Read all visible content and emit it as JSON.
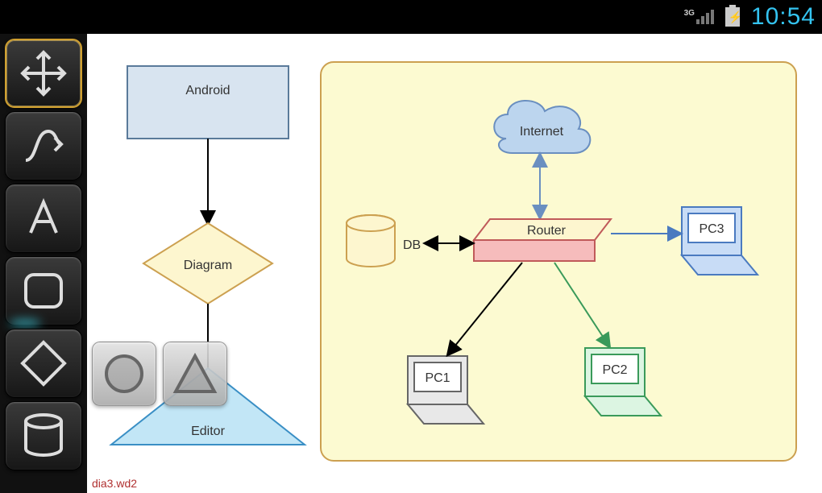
{
  "statusbar": {
    "signal": "3G",
    "time": "10:54"
  },
  "filename": "dia3.wd2",
  "toolbar": {
    "tools": [
      {
        "name": "move",
        "selected": true
      },
      {
        "name": "connector",
        "selected": false
      },
      {
        "name": "text",
        "selected": false
      },
      {
        "name": "rectangle",
        "selected": false,
        "highlight": true
      },
      {
        "name": "diamond",
        "selected": false
      },
      {
        "name": "cylinder",
        "selected": false
      }
    ]
  },
  "floating_tools": [
    {
      "name": "circle"
    },
    {
      "name": "triangle"
    }
  ],
  "diagram": {
    "shapes": {
      "android": {
        "label": "Android",
        "type": "rectangle",
        "fill": "#d8e4f0",
        "stroke": "#5a7a9a"
      },
      "diagram": {
        "label": "Diagram",
        "type": "diamond",
        "fill": "#fdf6cf",
        "stroke": "#cca050"
      },
      "editor": {
        "label": "Editor",
        "type": "triangle",
        "fill": "#c2e6f6",
        "stroke": "#3a8fc5"
      },
      "container": {
        "label": "",
        "type": "rounded-rect",
        "fill": "#fcfad1",
        "stroke": "#cca050"
      },
      "internet": {
        "label": "Internet",
        "type": "cloud",
        "fill": "#bcd5ee",
        "stroke": "#6a8fc0"
      },
      "router": {
        "label": "Router",
        "type": "router",
        "fill": "#f6bcbc",
        "stroke": "#c05a5a"
      },
      "db": {
        "label": "DB",
        "type": "cylinder",
        "fill": "#fdf6cf",
        "stroke": "#cca050"
      },
      "pc1": {
        "label": "PC1",
        "type": "pc",
        "fill": "#e0e0e0",
        "stroke": "#666666"
      },
      "pc2": {
        "label": "PC2",
        "type": "pc",
        "fill": "#c8f0d0",
        "stroke": "#3a9a5a"
      },
      "pc3": {
        "label": "PC3",
        "type": "pc",
        "fill": "#c8dcf6",
        "stroke": "#4a7ac0"
      }
    },
    "connectors": [
      {
        "from": "android",
        "to": "diagram",
        "style": "arrow"
      },
      {
        "from": "diagram",
        "to": "editor",
        "style": "arrow"
      },
      {
        "from": "internet",
        "to": "router",
        "style": "double-arrow",
        "color": "#6a8fc0"
      },
      {
        "from": "router",
        "to": "db",
        "style": "double-arrow",
        "color": "#000000"
      },
      {
        "from": "router",
        "to": "pc3",
        "style": "arrow",
        "color": "#4a7ac0"
      },
      {
        "from": "router",
        "to": "pc1",
        "style": "arrow",
        "color": "#000000"
      },
      {
        "from": "router",
        "to": "pc2",
        "style": "arrow",
        "color": "#3a9a5a"
      }
    ]
  }
}
